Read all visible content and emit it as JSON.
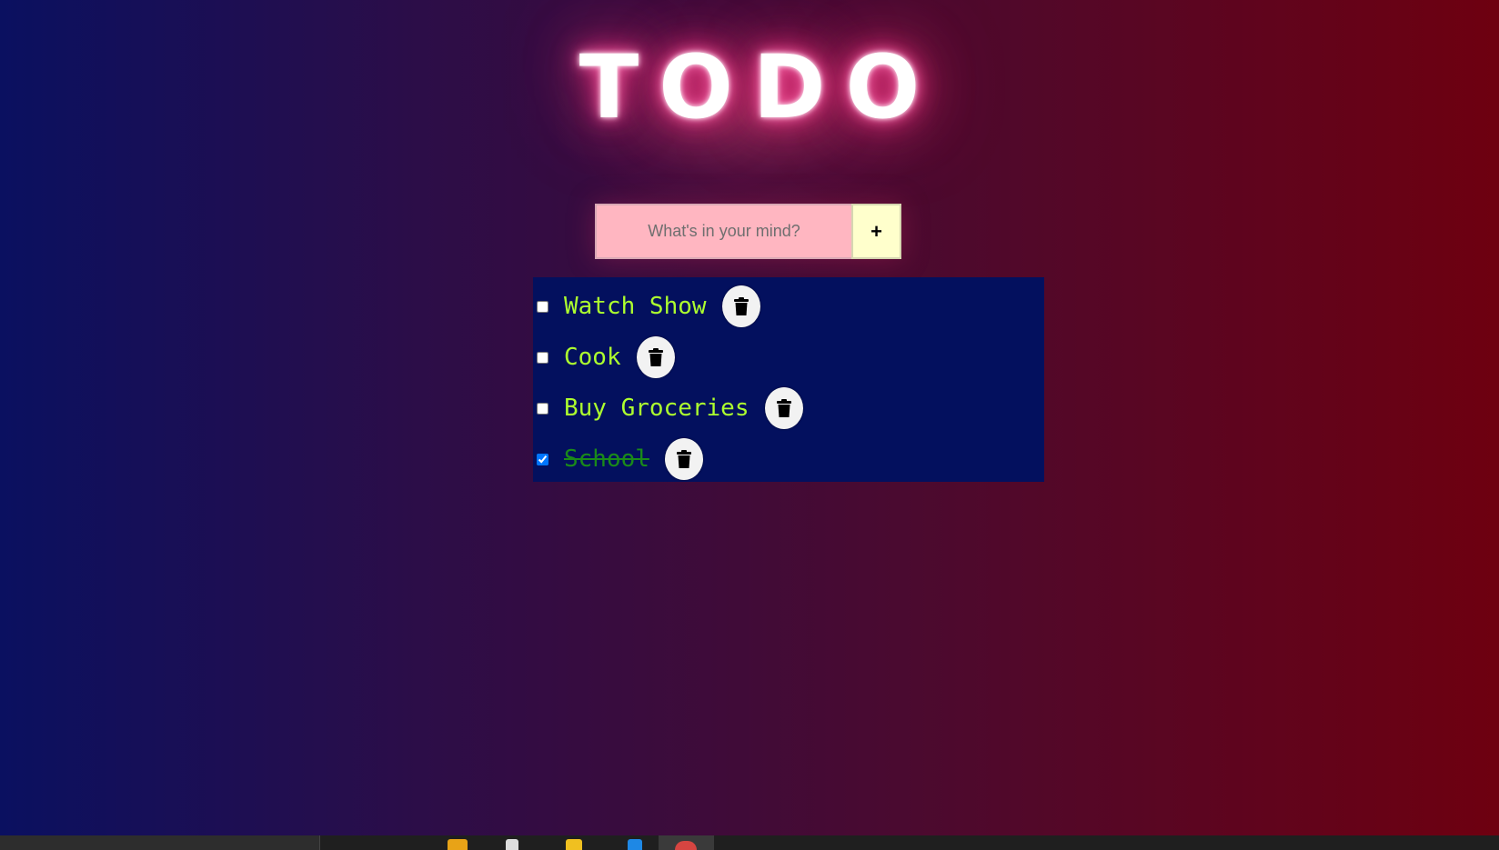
{
  "app": {
    "title": "TODO"
  },
  "form": {
    "placeholder": "What's in your mind?",
    "add_label": "+"
  },
  "todos": [
    {
      "text": "Watch Show",
      "done": false
    },
    {
      "text": "Cook",
      "done": false
    },
    {
      "text": "Buy Groceries",
      "done": false
    },
    {
      "text": "School",
      "done": true
    }
  ],
  "icons": {
    "delete": "trash-icon"
  },
  "colors": {
    "title_glow": "#ff3d8e",
    "input_bg": "#ffb6c1",
    "add_bg": "#ffffcc",
    "list_bg": "#03105e",
    "item_text": "#adff2f",
    "item_done_text": "#1a8a1a"
  }
}
